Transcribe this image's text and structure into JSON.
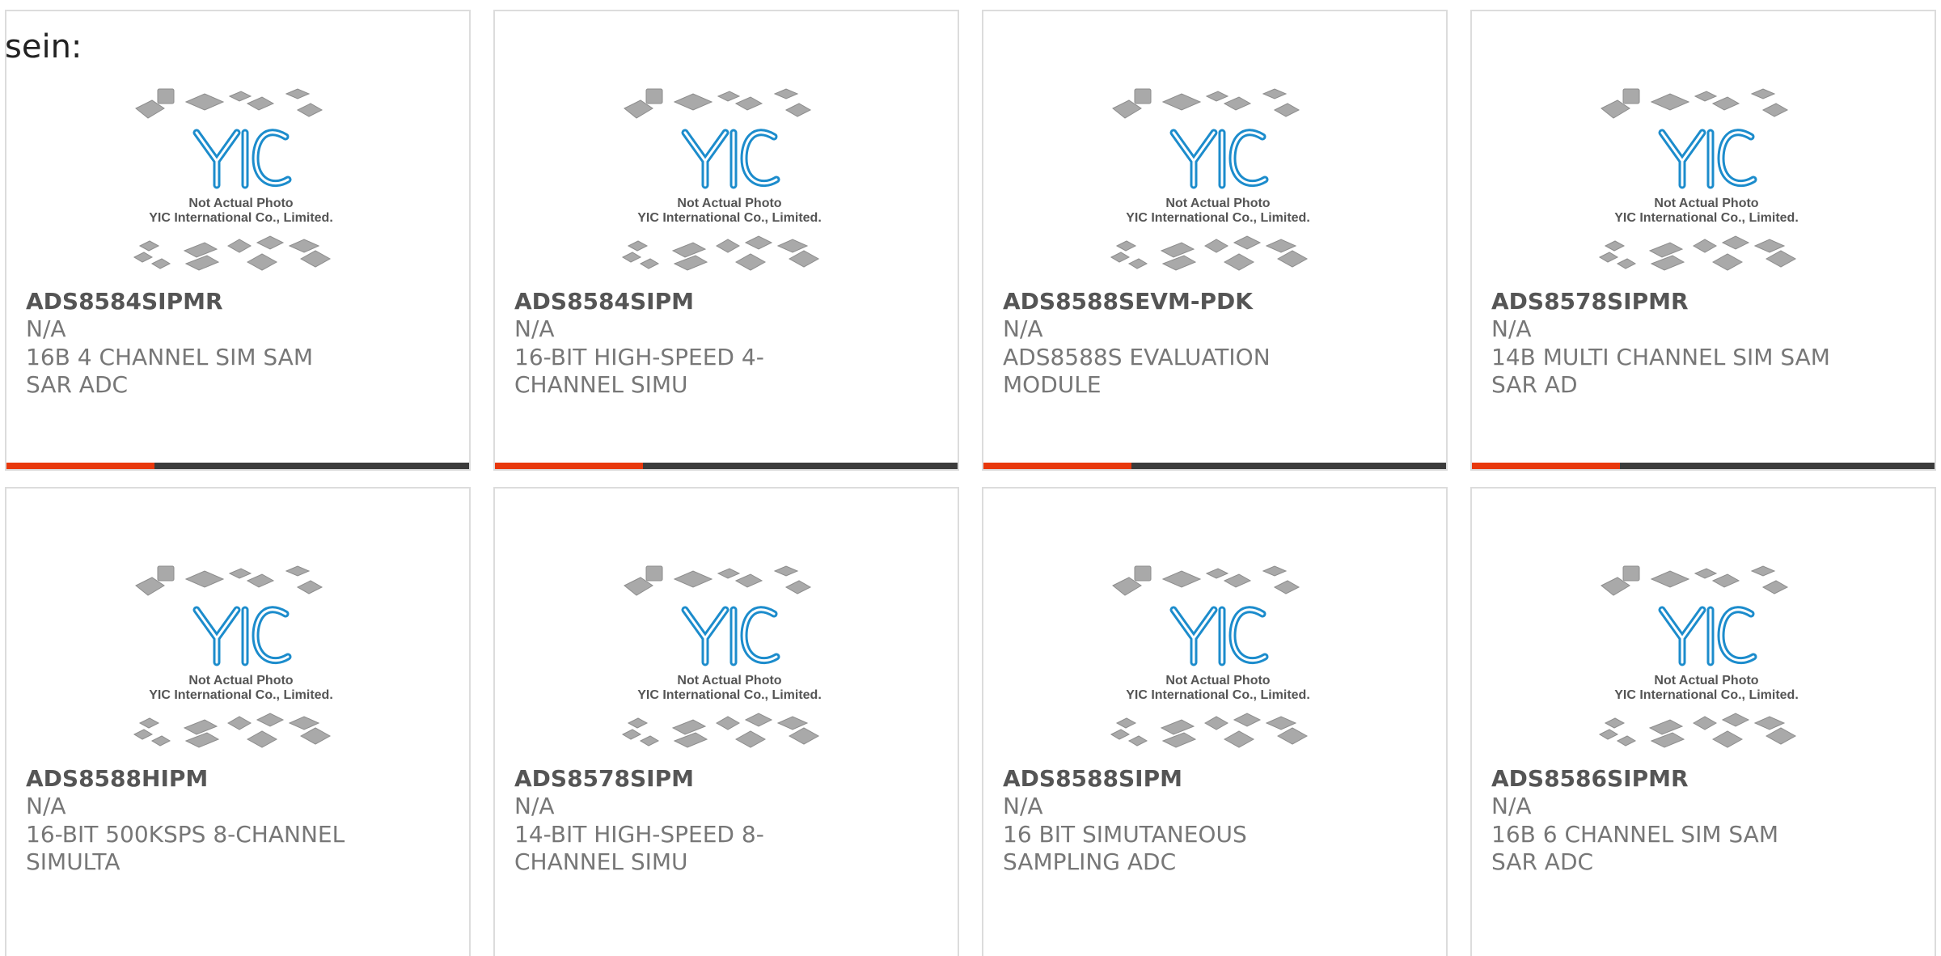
{
  "page": {
    "lead_text": "sein:"
  },
  "colors": {
    "accent": "#e8380d",
    "bar_dark": "#3b3b3b",
    "logo_blue": "#1c8ccc"
  },
  "placeholder_image": {
    "line1": "Not Actual Photo",
    "line2": "YIC International Co., Limited.",
    "logo": "YIC"
  },
  "products": [
    {
      "part": "ADS8584SIPMR",
      "manufacturer": "N/A",
      "description": "16B 4 CHANNEL SIM SAM SAR ADC"
    },
    {
      "part": "ADS8584SIPM",
      "manufacturer": "N/A",
      "description": "16-BIT HIGH-SPEED 4-CHANNEL SIMU"
    },
    {
      "part": "ADS8588SEVM-PDK",
      "manufacturer": "N/A",
      "description": "ADS8588S EVALUATION MODULE"
    },
    {
      "part": "ADS8578SIPMR",
      "manufacturer": "N/A",
      "description": "14B MULTI CHANNEL SIM SAM SAR AD"
    },
    {
      "part": "ADS8588HIPM",
      "manufacturer": "N/A",
      "description": "16-BIT 500KSPS 8-CHANNEL SIMULTA"
    },
    {
      "part": "ADS8578SIPM",
      "manufacturer": "N/A",
      "description": "14-BIT HIGH-SPEED 8-CHANNEL SIMU"
    },
    {
      "part": "ADS8588SIPM",
      "manufacturer": "N/A",
      "description": "16 BIT SIMUTANEOUS SAMPLING ADC"
    },
    {
      "part": "ADS8586SIPMR",
      "manufacturer": "N/A",
      "description": "16B 6 CHANNEL SIM SAM SAR ADC"
    }
  ]
}
